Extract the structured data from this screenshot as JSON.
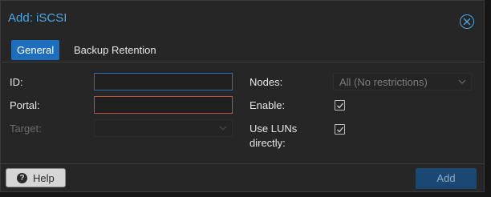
{
  "dialog": {
    "title": "Add: iSCSI",
    "close_icon": "close-circle-icon"
  },
  "tabs": [
    {
      "label": "General",
      "active": true
    },
    {
      "label": "Backup Retention",
      "active": false
    }
  ],
  "form": {
    "id": {
      "label": "ID:",
      "value": ""
    },
    "portal": {
      "label": "Portal:",
      "value": ""
    },
    "target": {
      "label": "Target:",
      "value": "",
      "disabled": true
    },
    "nodes": {
      "label": "Nodes:",
      "value": "All (No restrictions)"
    },
    "enable": {
      "label": "Enable:",
      "checked": true
    },
    "use_luns": {
      "label_line1": "Use LUNs",
      "label_line2": "directly:",
      "checked": true
    }
  },
  "footer": {
    "help_label": "Help",
    "help_icon": "question-circle-icon",
    "add_label": "Add"
  },
  "colors": {
    "accent": "#4aa8e8",
    "tab_active": "#1d6fbd",
    "invalid_border": "#c0503c",
    "add_button": "#1b4872"
  }
}
